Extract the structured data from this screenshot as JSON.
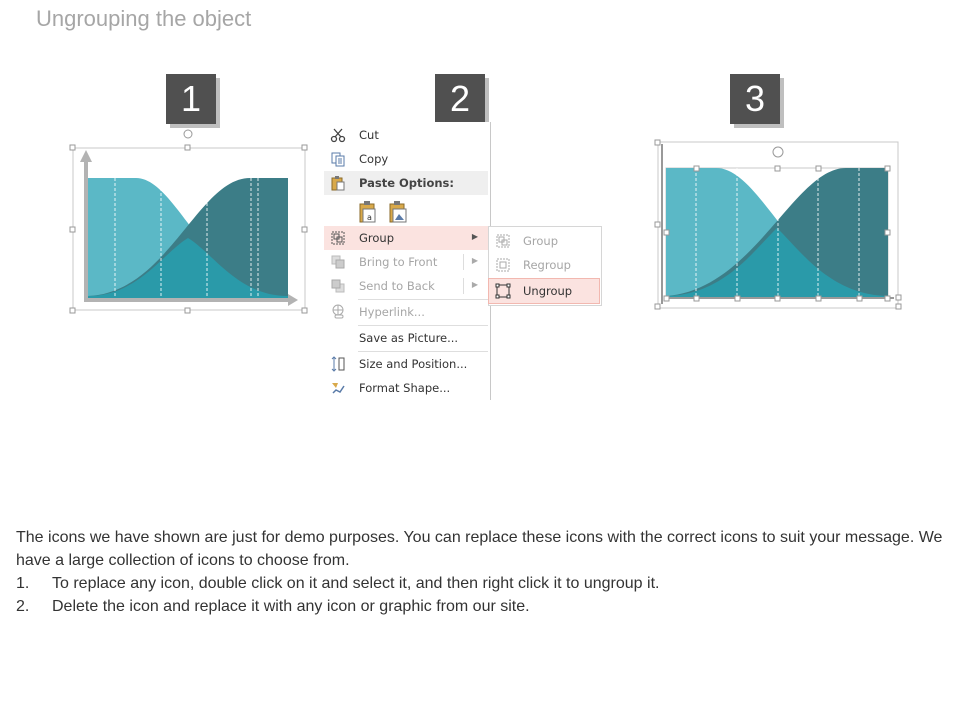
{
  "title": "Ungrouping the object",
  "steps": [
    "1",
    "2",
    "3"
  ],
  "colors": {
    "light_teal": "#5bb8c6",
    "dark_teal": "#3c7d87",
    "overlap_teal": "#2a9aa9",
    "badge": "#505050",
    "highlight": "#fbe3e0"
  },
  "context_menu": {
    "cut": "Cut",
    "copy": "Copy",
    "paste_options": "Paste Options:",
    "group": "Group",
    "bring_to_front": "Bring to Front",
    "send_to_back": "Send to Back",
    "hyperlink": "Hyperlink...",
    "save_as_picture": "Save as Picture...",
    "size_and_position": "Size and Position...",
    "format_shape": "Format Shape..."
  },
  "submenu": {
    "group": "Group",
    "regroup": "Regroup",
    "ungroup": "Ungroup"
  },
  "description": {
    "intro": "The icons we have shown are just for demo purposes. You can replace these icons with the correct icons to suit your message. We have a large collection of icons to choose from.",
    "items": [
      {
        "num": "1.",
        "text": "To replace any icon, double click on it and select it, and then right click it to ungroup it."
      },
      {
        "num": "2.",
        "text": "Delete the icon and replace it with any icon or graphic from our site."
      }
    ]
  }
}
